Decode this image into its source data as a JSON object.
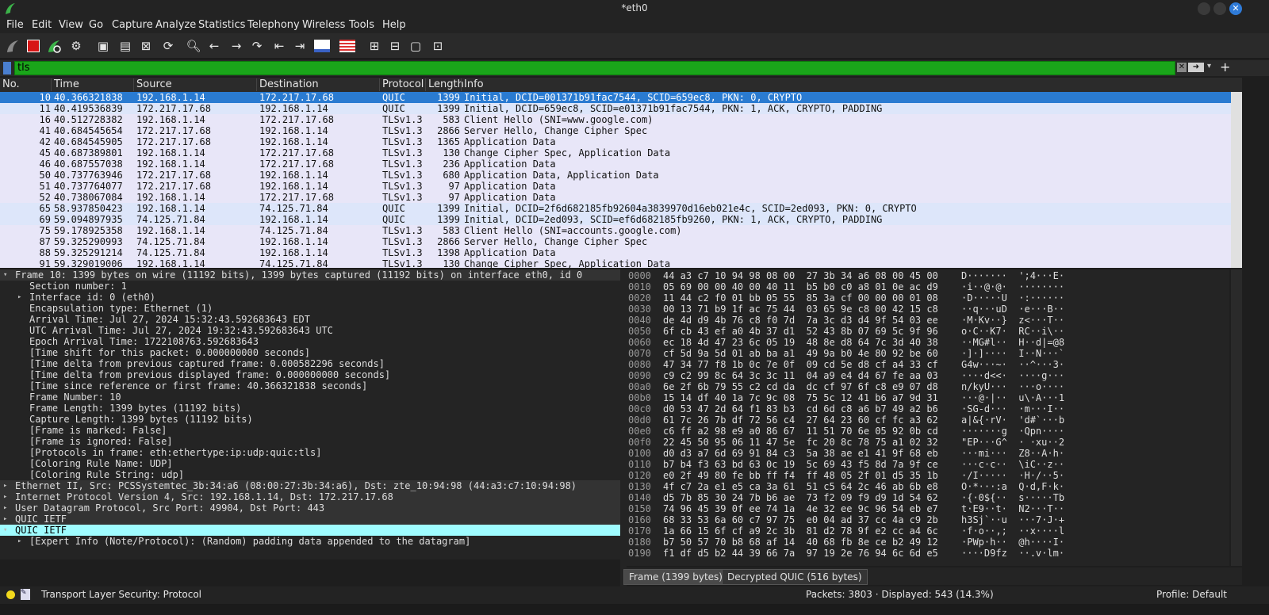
{
  "window": {
    "title": "*eth0",
    "close_glyph": "✕"
  },
  "menu": [
    "File",
    "Edit",
    "View",
    "Go",
    "Capture",
    "Analyze",
    "Statistics",
    "Telephony",
    "Wireless",
    "Tools",
    "Help"
  ],
  "filter": {
    "value": "tls"
  },
  "columns": [
    "No.",
    "Time",
    "Source",
    "Destination",
    "Protocol",
    "Length",
    "Info"
  ],
  "packets": [
    {
      "no": "10",
      "time": "40.366321838",
      "src": "192.168.1.14",
      "dst": "172.217.17.68",
      "proto": "QUIC",
      "len": "1399",
      "info": "Initial, DCID=001371b91fac7544, SCID=659ec8, PKN: 0, CRYPTO",
      "state": "sel"
    },
    {
      "no": "11",
      "time": "40.419536839",
      "src": "172.217.17.68",
      "dst": "192.168.1.14",
      "proto": "QUIC",
      "len": "1399",
      "info": "Initial, DCID=659ec8, SCID=e01371b91fac7544, PKN: 1, ACK, CRYPTO, PADDING",
      "state": "quic"
    },
    {
      "no": "16",
      "time": "40.512728382",
      "src": "192.168.1.14",
      "dst": "172.217.17.68",
      "proto": "TLSv1.3",
      "len": "583",
      "info": "Client Hello (SNI=www.google.com)",
      "state": "tls"
    },
    {
      "no": "41",
      "time": "40.684545654",
      "src": "172.217.17.68",
      "dst": "192.168.1.14",
      "proto": "TLSv1.3",
      "len": "2866",
      "info": "Server Hello, Change Cipher Spec",
      "state": "tls"
    },
    {
      "no": "42",
      "time": "40.684545905",
      "src": "172.217.17.68",
      "dst": "192.168.1.14",
      "proto": "TLSv1.3",
      "len": "1365",
      "info": "Application Data",
      "state": "tls"
    },
    {
      "no": "45",
      "time": "40.687389801",
      "src": "192.168.1.14",
      "dst": "172.217.17.68",
      "proto": "TLSv1.3",
      "len": "130",
      "info": "Change Cipher Spec, Application Data",
      "state": "tls"
    },
    {
      "no": "46",
      "time": "40.687557038",
      "src": "192.168.1.14",
      "dst": "172.217.17.68",
      "proto": "TLSv1.3",
      "len": "236",
      "info": "Application Data",
      "state": "tls"
    },
    {
      "no": "50",
      "time": "40.737763946",
      "src": "172.217.17.68",
      "dst": "192.168.1.14",
      "proto": "TLSv1.3",
      "len": "680",
      "info": "Application Data, Application Data",
      "state": "tls"
    },
    {
      "no": "51",
      "time": "40.737764077",
      "src": "172.217.17.68",
      "dst": "192.168.1.14",
      "proto": "TLSv1.3",
      "len": "97",
      "info": "Application Data",
      "state": "tls"
    },
    {
      "no": "52",
      "time": "40.738067084",
      "src": "192.168.1.14",
      "dst": "172.217.17.68",
      "proto": "TLSv1.3",
      "len": "97",
      "info": "Application Data",
      "state": "tls"
    },
    {
      "no": "65",
      "time": "58.937850423",
      "src": "192.168.1.14",
      "dst": "74.125.71.84",
      "proto": "QUIC",
      "len": "1399",
      "info": "Initial, DCID=2f6d682185fb92604a3839970d16eb021e4c, SCID=2ed093, PKN: 0, CRYPTO",
      "state": "quic"
    },
    {
      "no": "69",
      "time": "59.094897935",
      "src": "74.125.71.84",
      "dst": "192.168.1.14",
      "proto": "QUIC",
      "len": "1399",
      "info": "Initial, DCID=2ed093, SCID=ef6d682185fb9260, PKN: 1, ACK, CRYPTO, PADDING",
      "state": "quic"
    },
    {
      "no": "75",
      "time": "59.178925358",
      "src": "192.168.1.14",
      "dst": "74.125.71.84",
      "proto": "TLSv1.3",
      "len": "583",
      "info": "Client Hello (SNI=accounts.google.com)",
      "state": "tls"
    },
    {
      "no": "87",
      "time": "59.325290993",
      "src": "74.125.71.84",
      "dst": "192.168.1.14",
      "proto": "TLSv1.3",
      "len": "2866",
      "info": "Server Hello, Change Cipher Spec",
      "state": "tls"
    },
    {
      "no": "88",
      "time": "59.325291214",
      "src": "74.125.71.84",
      "dst": "192.168.1.14",
      "proto": "TLSv1.3",
      "len": "1398",
      "info": "Application Data",
      "state": "tls"
    },
    {
      "no": "91",
      "time": "59.329019006",
      "src": "192.168.1.14",
      "dst": "74.125.71.84",
      "proto": "TLSv1.3",
      "len": "130",
      "info": "Change Cipher Spec, Application Data",
      "state": "tls"
    }
  ],
  "details": [
    {
      "text": "Frame 10: 1399 bytes on wire (11192 bits), 1399 bytes captured (11192 bits) on interface eth0, id 0",
      "indent": 0,
      "arrow": "open",
      "kind": "grp"
    },
    {
      "text": "Section number: 1",
      "indent": 1,
      "arrow": "",
      "kind": ""
    },
    {
      "text": "Interface id: 0 (eth0)",
      "indent": 1,
      "arrow": "closed",
      "kind": ""
    },
    {
      "text": "Encapsulation type: Ethernet (1)",
      "indent": 1,
      "arrow": "",
      "kind": ""
    },
    {
      "text": "Arrival Time: Jul 27, 2024 15:32:43.592683643 EDT",
      "indent": 1,
      "arrow": "",
      "kind": ""
    },
    {
      "text": "UTC Arrival Time: Jul 27, 2024 19:32:43.592683643 UTC",
      "indent": 1,
      "arrow": "",
      "kind": ""
    },
    {
      "text": "Epoch Arrival Time: 1722108763.592683643",
      "indent": 1,
      "arrow": "",
      "kind": ""
    },
    {
      "text": "[Time shift for this packet: 0.000000000 seconds]",
      "indent": 1,
      "arrow": "",
      "kind": ""
    },
    {
      "text": "[Time delta from previous captured frame: 0.000582296 seconds]",
      "indent": 1,
      "arrow": "",
      "kind": ""
    },
    {
      "text": "[Time delta from previous displayed frame: 0.000000000 seconds]",
      "indent": 1,
      "arrow": "",
      "kind": ""
    },
    {
      "text": "[Time since reference or first frame: 40.366321838 seconds]",
      "indent": 1,
      "arrow": "",
      "kind": ""
    },
    {
      "text": "Frame Number: 10",
      "indent": 1,
      "arrow": "",
      "kind": ""
    },
    {
      "text": "Frame Length: 1399 bytes (11192 bits)",
      "indent": 1,
      "arrow": "",
      "kind": ""
    },
    {
      "text": "Capture Length: 1399 bytes (11192 bits)",
      "indent": 1,
      "arrow": "",
      "kind": ""
    },
    {
      "text": "[Frame is marked: False]",
      "indent": 1,
      "arrow": "",
      "kind": ""
    },
    {
      "text": "[Frame is ignored: False]",
      "indent": 1,
      "arrow": "",
      "kind": ""
    },
    {
      "text": "[Protocols in frame: eth:ethertype:ip:udp:quic:tls]",
      "indent": 1,
      "arrow": "",
      "kind": ""
    },
    {
      "text": "[Coloring Rule Name: UDP]",
      "indent": 1,
      "arrow": "",
      "kind": ""
    },
    {
      "text": "[Coloring Rule String: udp]",
      "indent": 1,
      "arrow": "",
      "kind": ""
    },
    {
      "text": "Ethernet II, Src: PCSSystemtec_3b:34:a6 (08:00:27:3b:34:a6), Dst: zte_10:94:98 (44:a3:c7:10:94:98)",
      "indent": 0,
      "arrow": "closed",
      "kind": "grp"
    },
    {
      "text": "Internet Protocol Version 4, Src: 192.168.1.14, Dst: 172.217.17.68",
      "indent": 0,
      "arrow": "closed",
      "kind": "grp"
    },
    {
      "text": "User Datagram Protocol, Src Port: 49904, Dst Port: 443",
      "indent": 0,
      "arrow": "closed",
      "kind": "grp"
    },
    {
      "text": "QUIC IETF",
      "indent": 0,
      "arrow": "closed",
      "kind": "grp"
    },
    {
      "text": "QUIC IETF",
      "indent": 0,
      "arrow": "open",
      "kind": "hl"
    },
    {
      "text": "[Expert Info (Note/Protocol): (Random) padding data appended to the datagram]",
      "indent": 1,
      "arrow": "closed",
      "kind": ""
    }
  ],
  "bytes": [
    {
      "off": "0000",
      "hex": "44 a3 c7 10 94 98 08 00  27 3b 34 a6 08 00 45 00",
      "ascii": "D·······  ';4···E·"
    },
    {
      "off": "0010",
      "hex": "05 69 00 00 40 00 40 11  b5 b0 c0 a8 01 0e ac d9",
      "ascii": "·i··@·@·  ········"
    },
    {
      "off": "0020",
      "hex": "11 44 c2 f0 01 bb 05 55  85 3a cf 00 00 00 01 08",
      "ascii": "·D·····U  ·:······"
    },
    {
      "off": "0030",
      "hex": "00 13 71 b9 1f ac 75 44  03 65 9e c8 00 42 15 c8",
      "ascii": "··q···uD  ·e···B··"
    },
    {
      "off": "0040",
      "hex": "de 4d d9 4b 76 c8 f0 7d  7a 3c d3 d4 9f 54 03 ee",
      "ascii": "·M·Kv··}  z<···T··"
    },
    {
      "off": "0050",
      "hex": "6f cb 43 ef a0 4b 37 d1  52 43 8b 07 69 5c 9f 96",
      "ascii": "o·C··K7·  RC··i\\··"
    },
    {
      "off": "0060",
      "hex": "ec 18 4d 47 23 6c 05 19  48 8e d8 64 7c 3d 40 38",
      "ascii": "··MG#l··  H··d|=@8"
    },
    {
      "off": "0070",
      "hex": "cf 5d 9a 5d 01 ab ba a1  49 9a b0 4e 80 92 be 60",
      "ascii": "·]·]····  I··N···`"
    },
    {
      "off": "0080",
      "hex": "47 34 77 f8 1b 0c 7e 0f  09 cd 5e d8 cf a4 33 cf",
      "ascii": "G4w···~·  ··^···3·"
    },
    {
      "off": "0090",
      "hex": "c9 c2 99 8c 64 3c 3c 11  04 a9 e4 d4 67 fe aa 03",
      "ascii": "····d<<·  ····g···"
    },
    {
      "off": "00a0",
      "hex": "6e 2f 6b 79 55 c2 cd da  dc cf 97 6f c8 e9 07 d8",
      "ascii": "n/kyU···  ···o····"
    },
    {
      "off": "00b0",
      "hex": "15 14 df 40 1a 7c 9c 08  75 5c 12 41 b6 a7 9d 31",
      "ascii": "···@·|··  u\\·A···1"
    },
    {
      "off": "00c0",
      "hex": "d0 53 47 2d 64 f1 83 b3  cd 6d c8 a6 b7 49 a2 b6",
      "ascii": "·SG-d···  ·m···I··"
    },
    {
      "off": "00d0",
      "hex": "61 7c 26 7b df 72 56 c4  27 64 23 60 cf fc a3 62",
      "ascii": "a|&{·rV·  'd#`···b"
    },
    {
      "off": "00e0",
      "hex": "c6 ff a2 98 e9 a0 86 67  11 51 70 6e 05 92 0b cd",
      "ascii": "·······g  ·Qpn····"
    },
    {
      "off": "00f0",
      "hex": "22 45 50 95 06 11 47 5e  fc 20 8c 78 75 a1 02 32",
      "ascii": "\"EP···G^  · ·xu··2"
    },
    {
      "off": "0100",
      "hex": "d0 d3 a7 6d 69 91 84 c3  5a 38 ae e1 41 9f 68 eb",
      "ascii": "···mi···  Z8··A·h·"
    },
    {
      "off": "0110",
      "hex": "b7 b4 f3 63 bd 63 0c 19  5c 69 43 f5 8d 7a 9f ce",
      "ascii": "···c·c··  \\iC··z··"
    },
    {
      "off": "0120",
      "hex": "e0 2f 49 80 fe bb ff f4  ff 48 05 2f 01 d5 35 1b",
      "ascii": "·/I·····  ·H·/··5·"
    },
    {
      "off": "0130",
      "hex": "4f c7 2a e1 e5 ca 3a 61  51 c5 64 2c 46 ab 6b e8",
      "ascii": "O·*···:a  Q·d,F·k·"
    },
    {
      "off": "0140",
      "hex": "d5 7b 85 30 24 7b b6 ae  73 f2 09 f9 d9 1d 54 62",
      "ascii": "·{·0${··  s·····Tb"
    },
    {
      "off": "0150",
      "hex": "74 96 45 39 0f ee 74 1a  4e 32 ee 9c 96 54 eb e7",
      "ascii": "t·E9··t·  N2···T··"
    },
    {
      "off": "0160",
      "hex": "68 33 53 6a 60 c7 97 75  e0 04 ad 37 cc 4a c9 2b",
      "ascii": "h3Sj`··u  ···7·J·+"
    },
    {
      "off": "0170",
      "hex": "1a 66 15 6f cf a9 2c 3b  81 d2 78 9f e2 cc a4 6c",
      "ascii": "·f·o··,;  ··x····l"
    },
    {
      "off": "0180",
      "hex": "b7 50 57 70 b8 68 af 14  40 68 fb 8e ce b2 49 12",
      "ascii": "·PWp·h··  @h····I·"
    },
    {
      "off": "0190",
      "hex": "f1 df d5 b2 44 39 66 7a  97 19 2e 76 94 6c 6d e5",
      "ascii": "····D9fz  ··.v·lm·"
    }
  ],
  "byte_tabs": [
    "Frame (1399 bytes)",
    "Decrypted QUIC (516 bytes)"
  ],
  "status": {
    "field": "Transport Layer Security: Protocol",
    "packets": "Packets: 3803 · Displayed: 543 (14.3%)",
    "profile": "Profile: Default"
  },
  "colors": {
    "selected": "#2a7bd1",
    "quic_row": "#dde6fa",
    "tls_row": "#e8e6f8",
    "filter_ok": "#1aa51a",
    "highlight": "#9ffcff"
  }
}
